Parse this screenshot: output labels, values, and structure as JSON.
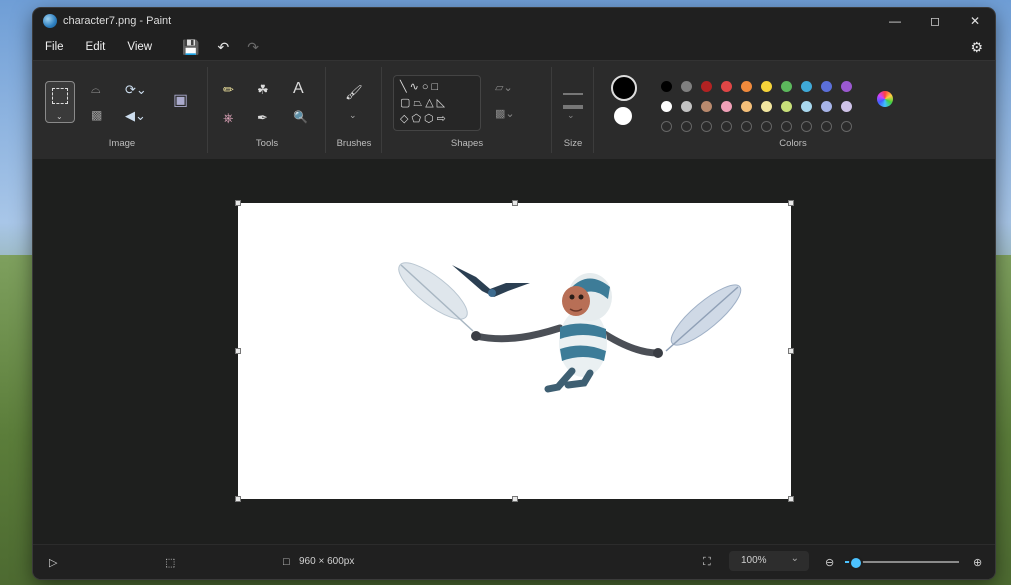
{
  "window": {
    "title": "character7.png - Paint"
  },
  "menu": {
    "file": "File",
    "edit": "Edit",
    "view": "View"
  },
  "ribbon": {
    "groups": {
      "image": "Image",
      "tools": "Tools",
      "brushes": "Brushes",
      "shapes": "Shapes",
      "size": "Size",
      "colors": "Colors"
    },
    "tools": {
      "text_glyph": "A"
    },
    "primary_color": "#000000",
    "secondary_color": "#ffffff",
    "palette_row1": [
      "#000000",
      "#7f7f7f",
      "#b22222",
      "#e04646",
      "#f08a3c",
      "#f5d33a",
      "#5cb85c",
      "#3fa9d8",
      "#5b6fd9",
      "#9b59d0"
    ],
    "palette_row2": [
      "#ffffff",
      "#c3c3c3",
      "#b98a6e",
      "#f0a0b8",
      "#f5c07a",
      "#f2e6a0",
      "#c8e07a",
      "#a9d8ee",
      "#a7b4e8",
      "#cfc3e8"
    ]
  },
  "status": {
    "canvas_size": "960 × 600px",
    "zoom": "100%"
  },
  "zoom_slider_level": 0.1
}
